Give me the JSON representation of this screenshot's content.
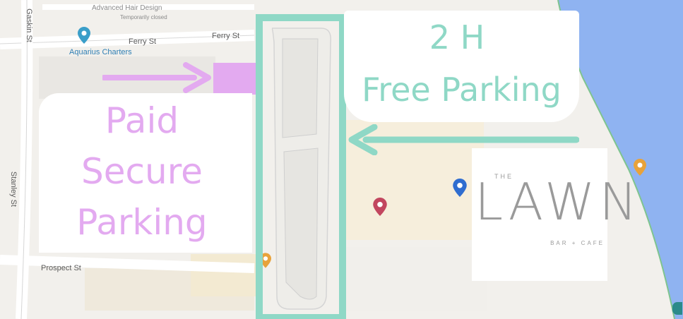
{
  "colors": {
    "free_parking": "#8fd8c6",
    "paid_parking": "#e3aaf0",
    "water": "#8fb3f1",
    "lawn_logo": "#9a9a9a"
  },
  "map": {
    "streets": {
      "ferry_st_a": "Ferry St",
      "ferry_st_b": "Ferry St",
      "prospect_st": "Prospect St",
      "stanley_st": "Stanley St",
      "gaskin_st": "Gaskin St"
    },
    "poi": {
      "aquarius_charters": "Aquarius Charters"
    },
    "faded": {
      "top_business": "Advanced Hair Design",
      "top_business_sub": "Temporarily closed"
    }
  },
  "free_parking": {
    "line1": "2 H",
    "line2": "Free Parking"
  },
  "paid_parking": {
    "line1": "Paid",
    "line2": "Secure",
    "line3": "Parking"
  },
  "logo": {
    "top": "THE",
    "name": "LAWN",
    "tag": "BAR + CAFE"
  },
  "icons": {
    "left_arrow": "arrow-right-icon",
    "right_arrow": "arrow-left-icon",
    "pin_blue_left": "map-pin-icon",
    "pin_red": "map-pin-icon",
    "pin_blue_right": "map-pin-icon",
    "pin_orange": "map-pin-icon"
  }
}
